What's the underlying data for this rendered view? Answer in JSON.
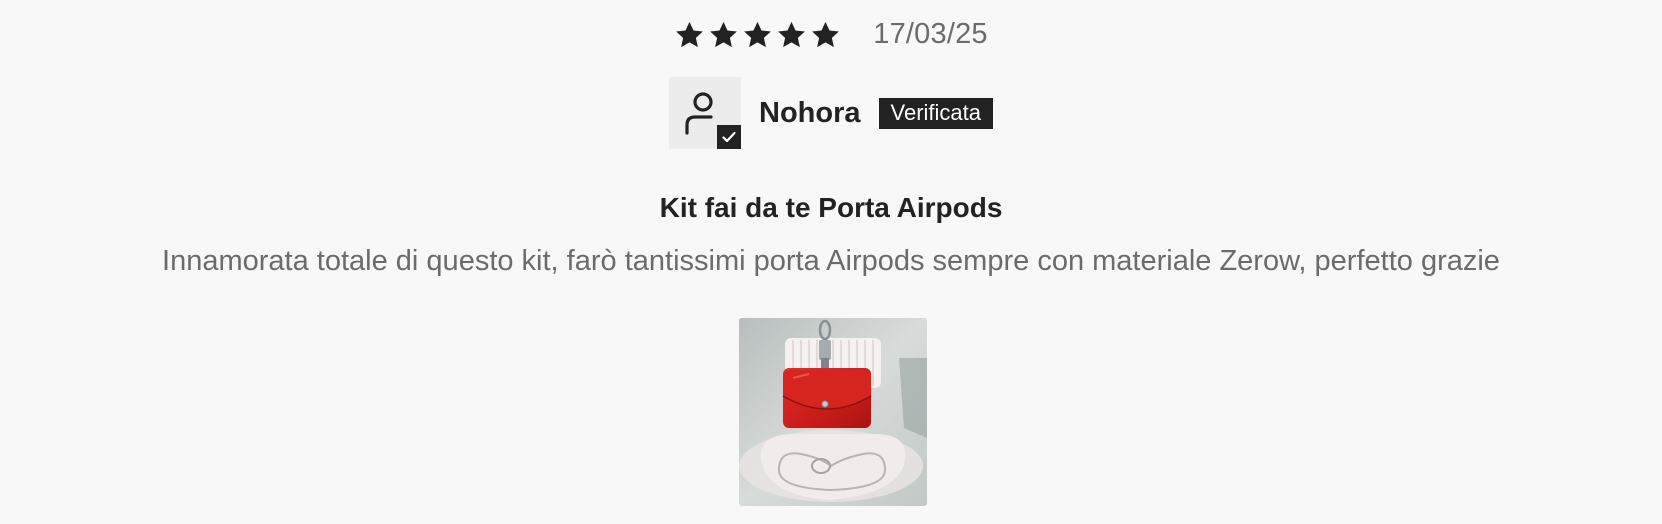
{
  "rating": {
    "stars_filled": 5,
    "stars_total": 5,
    "date": "17/03/25",
    "icon": "star-icon"
  },
  "author": {
    "name": "Nohora",
    "badge": "Verificata",
    "avatar_icon": "user-icon",
    "check_icon": "checkmark-icon"
  },
  "review": {
    "title": "Kit fai da te Porta Airpods",
    "body": "Innamorata totale di questo kit, farò tantissimi porta Airpods sempre con materiale Zerow, perfetto grazie"
  },
  "photo": {
    "subject": "review-photo"
  },
  "colors": {
    "background": "#f8f8f8",
    "text_primary": "#222222",
    "text_secondary": "#6b6b6b",
    "badge_bg": "#222222",
    "badge_text": "#ffffff",
    "product_red": "#d3201d"
  }
}
